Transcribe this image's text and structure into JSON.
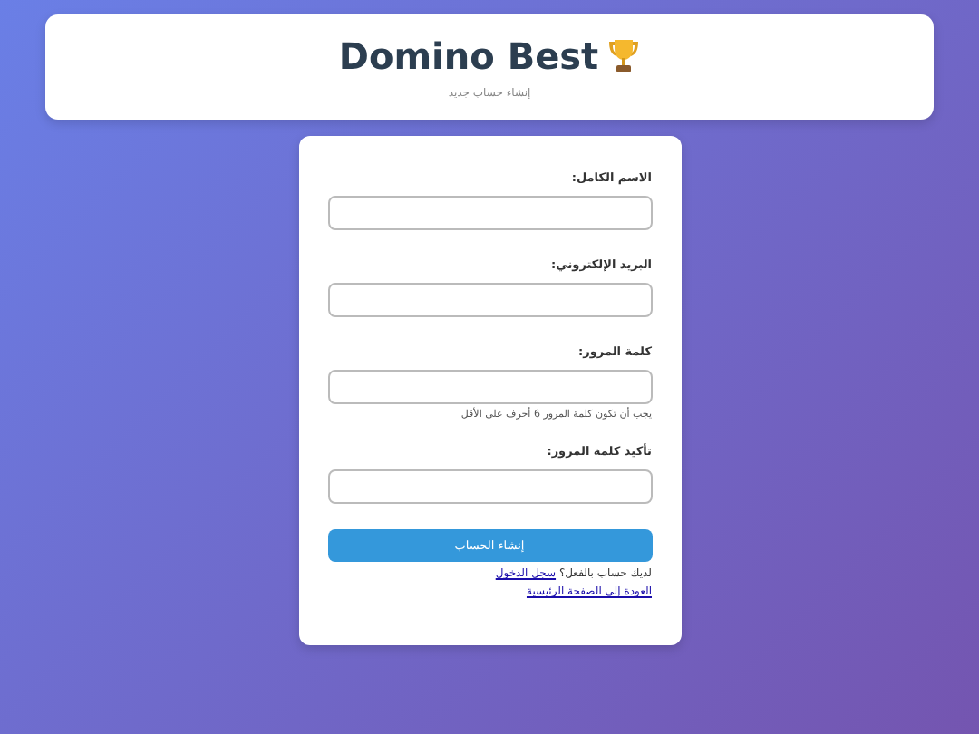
{
  "header": {
    "title": "Domino Best",
    "subtitle": "إنشاء حساب جديد"
  },
  "fields": [
    {
      "label": "الاسم الكامل:"
    },
    {
      "label": "البريد الإلكتروني:"
    },
    {
      "label": "كلمة المرور:",
      "hint": "يجب أن تكون كلمة المرور 6 أحرف على الأقل"
    },
    {
      "label": "تأكيد كلمة المرور:"
    }
  ],
  "submit": "إنشاء الحساب",
  "login_prompt": {
    "text": "لديك حساب بالفعل؟",
    "link": "سجل الدخول"
  },
  "home_link": "العودة إلى الصفحة الرئيسية"
}
